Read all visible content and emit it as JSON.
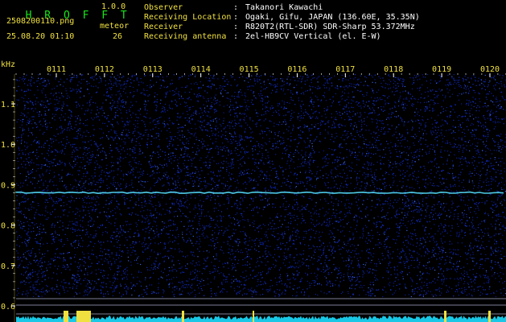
{
  "app": {
    "title": "H R O F F T",
    "version": "1.0.0"
  },
  "capture": {
    "file": "2508200110.png",
    "datetime": "25.08.20 01:10"
  },
  "meteor": {
    "label": "meteor",
    "count": "26"
  },
  "info": [
    {
      "label": "Observer",
      "value": "Takanori Kawachi"
    },
    {
      "label": "Receiving Location",
      "value": "Ogaki, Gifu, JAPAN (136.60E, 35.35N)"
    },
    {
      "label": "Receiver",
      "value": "R820T2(RTL-SDR) SDR-Sharp 53.372MHz"
    },
    {
      "label": "Receiving antenna",
      "value": "2el-HB9CV Vertical (el. E-W)"
    }
  ],
  "colors": {
    "background": "#000000",
    "noise": "#0a1e9a",
    "signal": "#55e0ff",
    "axis_text": "#f0e040",
    "header_green": "#19e619",
    "power_trace": "#19c8e6",
    "power_peak": "#f0e040"
  },
  "chart_data": {
    "type": "heatmap",
    "ylabel": "kHz",
    "x": {
      "tick_labels": [
        "0111",
        "0112",
        "0113",
        "0114",
        "0115",
        "0116",
        "0117",
        "0118",
        "0119",
        "0120"
      ]
    },
    "y": {
      "range": [
        0.6,
        1.2
      ],
      "ticks": [
        0.6,
        0.7,
        0.8,
        0.9,
        1.0,
        1.1
      ],
      "tick_labels": [
        "0.6",
        "0.7",
        "0.8",
        "0.9",
        "1.0",
        "1.1"
      ]
    },
    "carrier_khz": 0.88,
    "grid": false
  }
}
